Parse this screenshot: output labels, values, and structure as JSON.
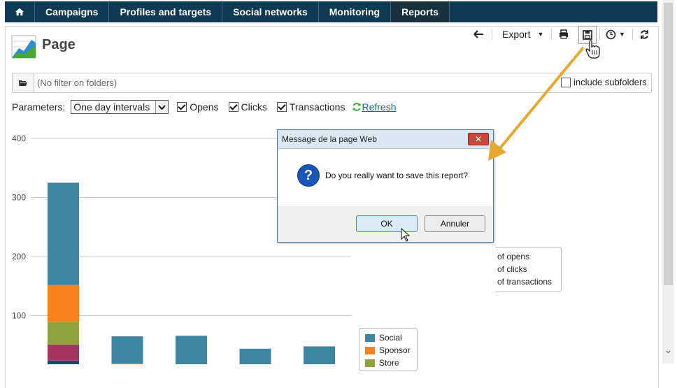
{
  "nav": {
    "home": "home-icon",
    "items": [
      "Campaigns",
      "Profiles and targets",
      "Social networks",
      "Monitoring",
      "Reports"
    ],
    "active": "Reports"
  },
  "page": {
    "title": "Page",
    "icon": "report-chart-icon"
  },
  "toolbar": {
    "export_label": "Export"
  },
  "filter": {
    "placeholder": "(No filter on folders)",
    "include_subfolders": "include subfolders"
  },
  "params": {
    "label": "Parameters:",
    "interval": "One day intervals",
    "checks": [
      "Opens",
      "Clicks",
      "Transactions"
    ],
    "refresh": "Refresh"
  },
  "dialog": {
    "title": "Message de la page Web",
    "message": "Do you really want to save this report?",
    "ok": "OK",
    "cancel": "Annuler"
  },
  "legend1": [
    "of opens",
    "of clicks",
    "of transactions"
  ],
  "colors": {
    "social": "#3d86a3",
    "sponsor": "#f8831d",
    "store": "#8ea33e",
    "seg4": "#a6365e",
    "seg5": "#0e4f6b",
    "nav_bg": "#0f3a53",
    "arrow": "#e8a730"
  },
  "chart_data": {
    "type": "bar",
    "stacked": true,
    "yticks": [
      100,
      200,
      300,
      400
    ],
    "ylim": [
      0,
      400
    ],
    "grid": true,
    "legend": [
      "Social",
      "Sponsor",
      "Store"
    ],
    "series": [
      {
        "name": "Social",
        "color": "#3d86a3",
        "values": [
          173,
          46,
          50,
          40,
          39
        ]
      },
      {
        "name": "Sponsor",
        "color": "#f8831d",
        "values": [
          63,
          13,
          8,
          4,
          7
        ]
      },
      {
        "name": "Store",
        "color": "#8ea33e",
        "values": [
          38,
          6,
          5,
          0,
          2
        ]
      },
      {
        "color": "#a6365e",
        "values": [
          27,
          0,
          2,
          0,
          0
        ]
      },
      {
        "color": "#0e4f6b",
        "values": [
          24,
          0,
          1,
          0,
          0
        ]
      }
    ]
  }
}
